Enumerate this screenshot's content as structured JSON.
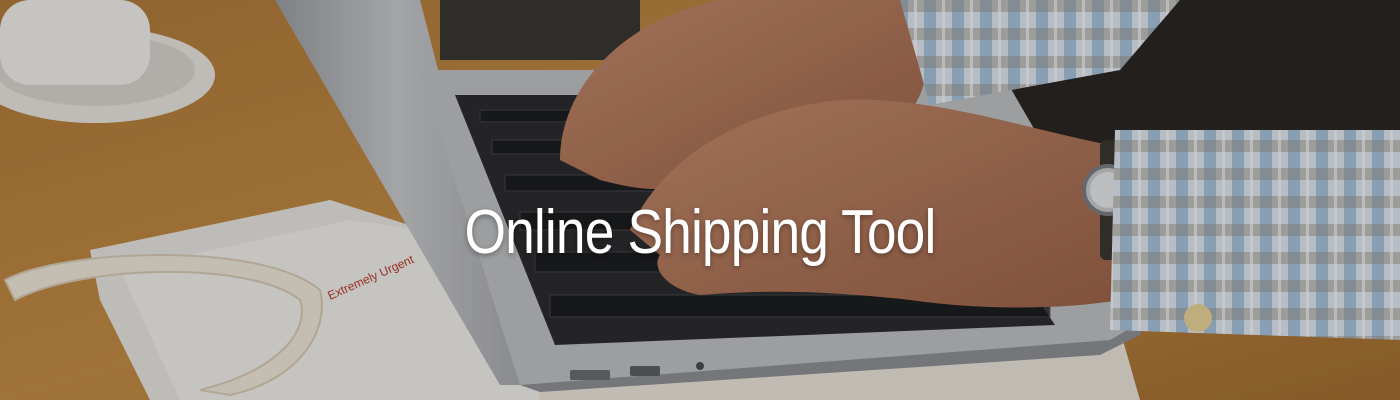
{
  "hero": {
    "title": "Online Shipping Tool",
    "image_subject": "hands-typing-on-laptop-photo",
    "envelope_stamp": "Extremely Urgent",
    "overlay_color": "#000000"
  }
}
